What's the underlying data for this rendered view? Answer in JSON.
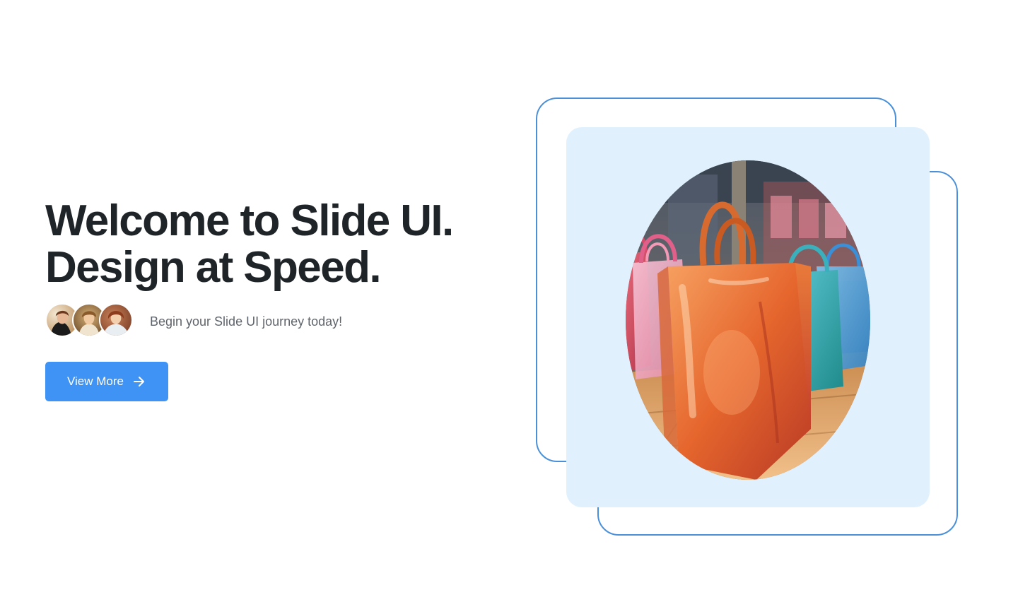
{
  "hero": {
    "title_line_1": "Welcome to Slide UI.",
    "title_line_2": "Design at Speed.",
    "tagline": "Begin your Slide UI journey today!"
  },
  "avatars": [
    {
      "name": "avatar-1"
    },
    {
      "name": "avatar-2"
    },
    {
      "name": "avatar-3"
    }
  ],
  "cta": {
    "label": "View More",
    "icon": "arrow-right-icon"
  },
  "colors": {
    "accent": "#3f93f5",
    "heading": "#1f2428",
    "body_text": "#5f656c",
    "frame_border": "#4a90d9",
    "card_background": "#e0f1fd"
  }
}
